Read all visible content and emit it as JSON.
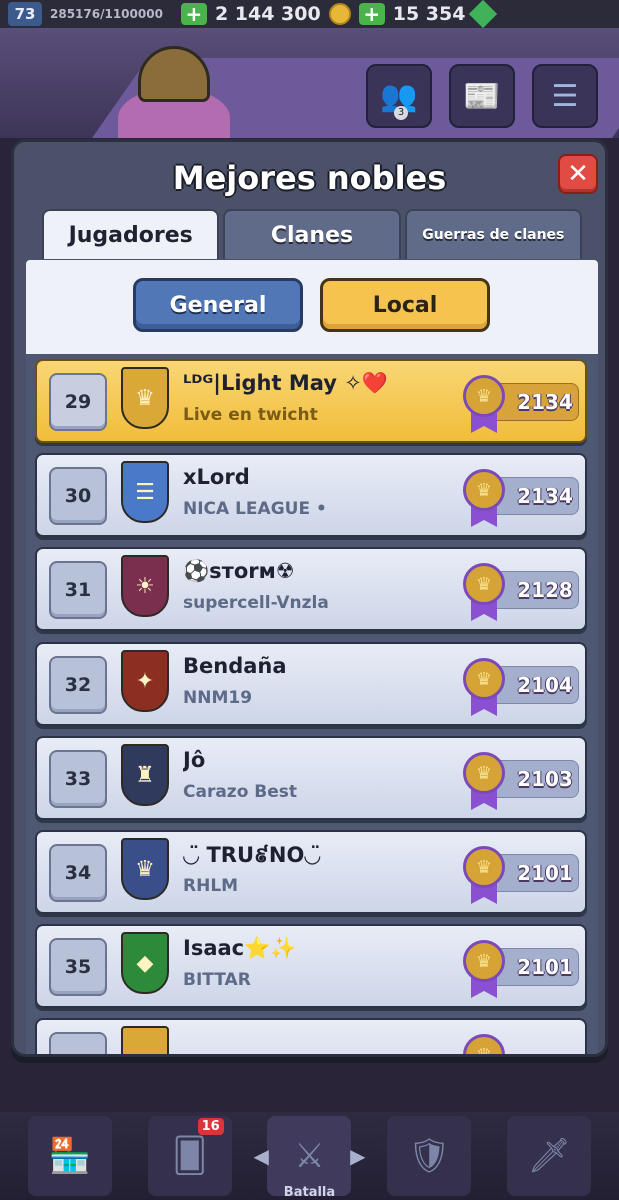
{
  "topbar": {
    "level": "73",
    "xp": "285176/1100000",
    "gold": "2 144 300",
    "gems": "15 354"
  },
  "scene": {
    "friends_count": "3"
  },
  "modal": {
    "title": "Mejores nobles",
    "close_label": "✕",
    "tabs": [
      {
        "label": "Jugadores",
        "active": true
      },
      {
        "label": "Clanes",
        "active": false
      },
      {
        "label": "Guerras de clanes",
        "active": false
      }
    ],
    "filters": {
      "general_label": "General",
      "local_label": "Local",
      "selected": "Local"
    },
    "rows": [
      {
        "rank": "29",
        "name": "ᴸᴰᴳ|Light May ✧❤️",
        "clan": "Live en twicht",
        "trophies": "2134",
        "highlight": true,
        "badge_color": "#d9a836",
        "badge_icon": "♛"
      },
      {
        "rank": "30",
        "name": "xLord",
        "clan": "NICA LEAGUE •",
        "trophies": "2134",
        "highlight": false,
        "badge_color": "#4a79c9",
        "badge_icon": "☰"
      },
      {
        "rank": "31",
        "name": "⚽sтorм☢",
        "clan": "supercell-Vnzla",
        "trophies": "2128",
        "highlight": false,
        "badge_color": "#7a2f4f",
        "badge_icon": "☀"
      },
      {
        "rank": "32",
        "name": "Bendaña",
        "clan": "NNM19",
        "trophies": "2104",
        "highlight": false,
        "badge_color": "#8c2f22",
        "badge_icon": "✦"
      },
      {
        "rank": "33",
        "name": "Jô",
        "clan": "Carazo Best",
        "trophies": "2103",
        "highlight": false,
        "badge_color": "#2f3a5c",
        "badge_icon": "♜"
      },
      {
        "rank": "34",
        "name": "◡̈ TRU៩NO◡̈",
        "clan": "RHLM",
        "trophies": "2101",
        "highlight": false,
        "badge_color": "#3a4f8a",
        "badge_icon": "♛"
      },
      {
        "rank": "35",
        "name": "Isaac⭐✨",
        "clan": "BITTAR",
        "trophies": "2101",
        "highlight": false,
        "badge_color": "#2d8a3a",
        "badge_icon": "◆"
      }
    ]
  },
  "bottom_nav": {
    "cards_badge": "16",
    "battle_label": "Batalla"
  }
}
